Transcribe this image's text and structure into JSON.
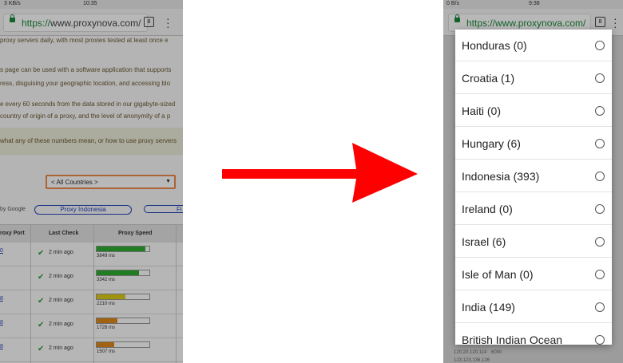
{
  "left_phone": {
    "status": {
      "left": "3 KB/s",
      "time": "10:35"
    },
    "url": {
      "scheme": "https://",
      "host": "www.proxynova.com/"
    },
    "tab_count": "8",
    "paragraphs": [
      "proxy servers daily, with most proxies tested at least once e",
      "s page can be used with a software application that supports",
      "ress, disguising your geographic location, and accessing blo",
      "e every 60 seconds from the data stored in our gigabyte-sized",
      "country of origin of a proxy, and the level of anonymity of a p"
    ],
    "notice": "what any of these numbers mean, or how to use proxy servers",
    "country_select": {
      "value": "< All Countries >"
    },
    "google_text": "by Google",
    "links": [
      "Proxy Indonesia",
      "Fi"
    ],
    "table": {
      "headers": [
        "roxy Port",
        "Last Check",
        "Proxy Speed"
      ],
      "rows": [
        {
          "port": "0",
          "check": "2 min ago",
          "speed": "3849 ms",
          "fill": 0.92,
          "color": "#2fae2f"
        },
        {
          "port": "",
          "check": "2 min ago",
          "speed": "3342 ms",
          "fill": 0.8,
          "color": "#2fae2f"
        },
        {
          "port": "8",
          "check": "2 min ago",
          "speed": "2210 ms",
          "fill": 0.55,
          "color": "#e0cc1a"
        },
        {
          "port": "8",
          "check": "2 min ago",
          "speed": "1728 ms",
          "fill": 0.4,
          "color": "#e08a1a"
        },
        {
          "port": "8",
          "check": "2 min ago",
          "speed": "1507 ms",
          "fill": 0.33,
          "color": "#e08a1a"
        }
      ]
    }
  },
  "right_phone": {
    "status": {
      "left": "0 B/s",
      "time": "9:38"
    },
    "url": {
      "text": "https://www.proxynova.com/"
    },
    "tab_count": "8",
    "behind_texts": [
      "120.20.120.114",
      "6000",
      "123,123,136,126"
    ],
    "options": [
      "Honduras (0)",
      "Croatia (1)",
      "Haiti (0)",
      "Hungary (6)",
      "Indonesia (393)",
      "Ireland (0)",
      "Israel (6)",
      "Isle of Man (0)",
      "India (149)",
      "British Indian Ocean"
    ]
  },
  "colors": {
    "arrow": "#ff0000",
    "url_green": "#1a8a3a",
    "select_border": "#ef8a4a",
    "link_blue": "#2244bb"
  }
}
